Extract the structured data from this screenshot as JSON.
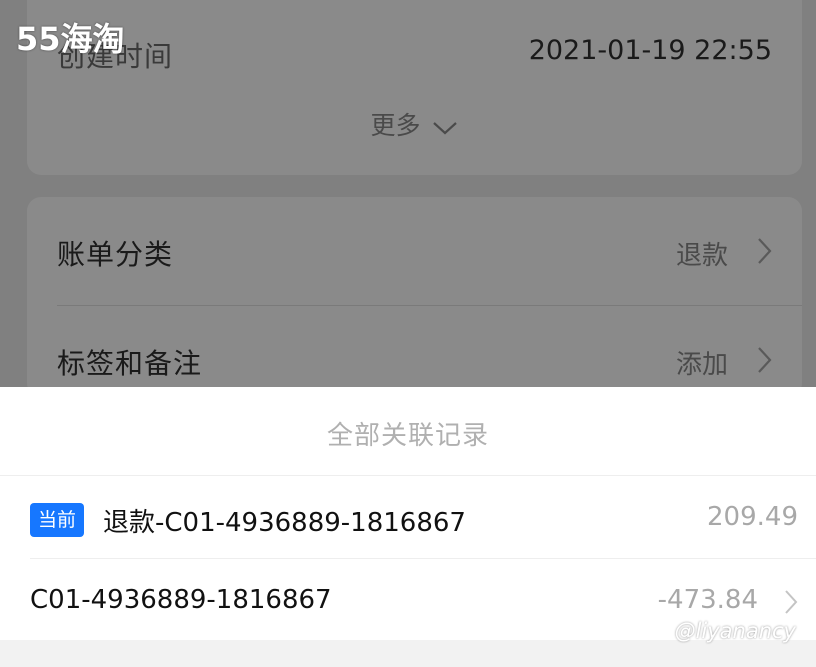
{
  "logo": "55海淘",
  "detail": {
    "created_time_label": "创建时间",
    "created_time_value": "2021-01-19 22:55",
    "more_label": "更多"
  },
  "settings": {
    "rows": [
      {
        "label": "账单分类",
        "value": "退款"
      },
      {
        "label": "标签和备注",
        "value": "添加"
      }
    ]
  },
  "sheet": {
    "title": "全部关联记录",
    "records": [
      {
        "badge": "当前",
        "name": "退款-C01-4936889-1816867",
        "amount": "209.49"
      },
      {
        "name": "C01-4936889-1816867",
        "amount": "-473.84"
      }
    ]
  },
  "watermark": "@liyanancy",
  "colors": {
    "accent": "#1677ff",
    "overlay": "#808080",
    "muted_text": "#a8a8a8"
  }
}
